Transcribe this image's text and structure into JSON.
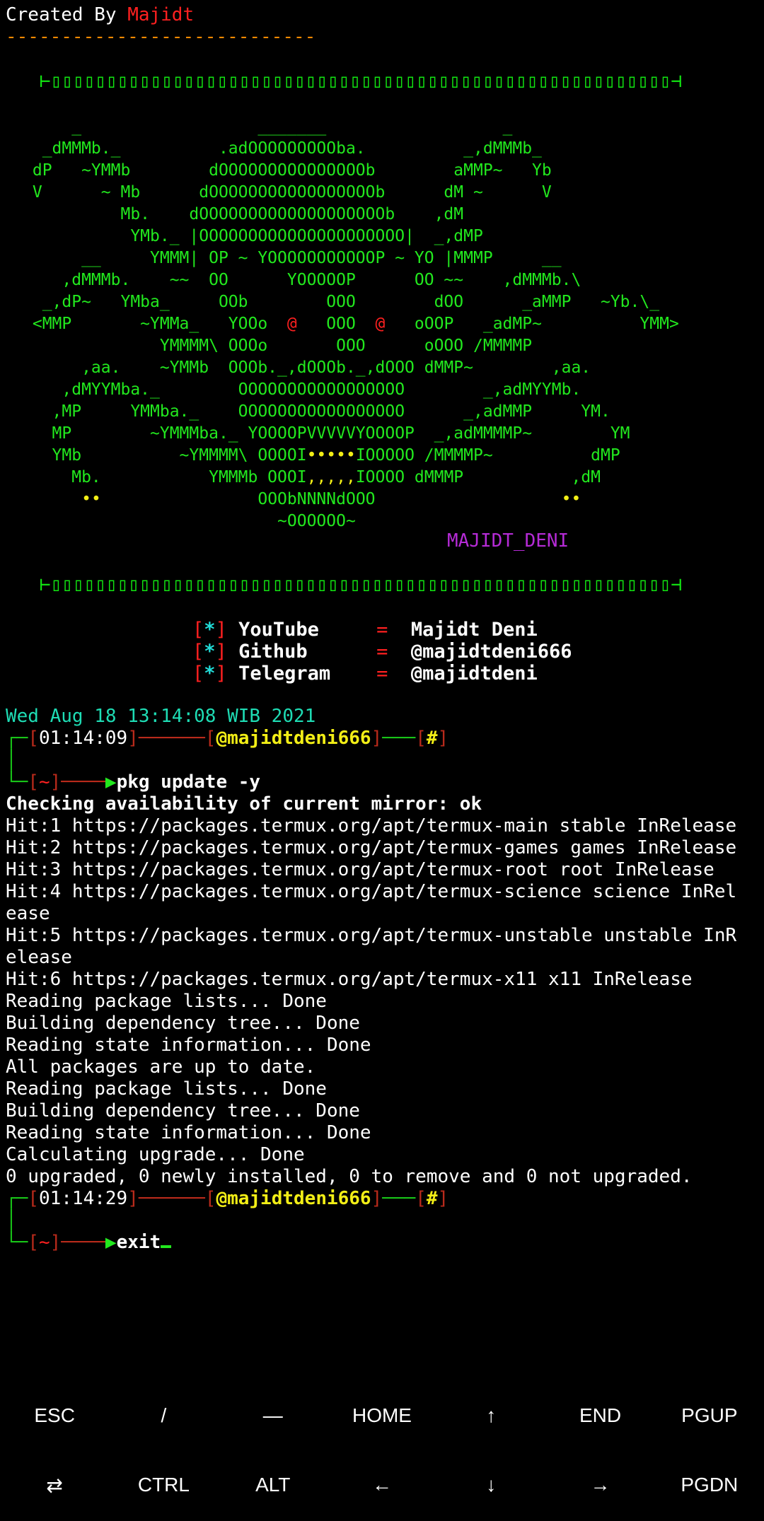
{
  "header": {
    "created_by": "Created By ",
    "author": "Majidt",
    "dashes": "----------------------------"
  },
  "banner": {
    "separator": "⊢▯▯▯▯▯▯▯▯▯▯▯▯▯▯▯▯▯▯▯▯▯▯▯▯▯▯▯▯▯▯▯▯▯▯▯▯▯▯▯▯▯▯▯▯▯▯▯▯▯▯▯▯▯▯▯▯⊣",
    "art_lines": [
      "     _                  _______                  _",
      "  _dMMMb._          .adOOOOOOOOOba.          _,dMMMb_",
      " dP   ~YMMb        dOOOOOOOOOOOOOOOb        aMMP~   Yb",
      " V      ~ Mb      dOOOOOOOOOOOOOOOOOb      dM ~      V",
      "          Mb.    dOOOOOOOOOOOOOOOOOOOb    ,dM",
      "           YMb._ |OOOOOOOOOOOOOOOOOOOOO|  _,dMP",
      "      __     YMMM| OP ~ YOOOOOOOOOOOP ~ YO |MMMP     __",
      "    ,dMMMb.    ~~  OO      YOOOOOP      OO ~~    ,dMMMb.\\",
      "  _,dP~   YMba_     OOb        OOO        dOO      _aMMP   ~Yb.\\_",
      " <MMP       ~YMMa_   YOOo  @   OOO  @   oOOP   _adMP~          YMM>",
      "              YMMMM\\ OOOo       OOO      oOOO /MMMMP",
      "      ,aa.    ~YMMb  OOOb._,dOOOb._,dOOO dMMP~        ,aa.",
      "    ,dMYYMba._        OOOOOOOOOOOOOOOOO        _,adMYYMb.",
      "   ,MP     YMMba._    OOOOOOOOOOOOOOOOO      _,adMMP     YM.",
      "   MP        ~YMMMba._ YOOOOPVVVVVYOOOOP  _,adMMMMP~        YM",
      "   YMb          ~YMMMM\\ OOOOI•••••IOOOOO /MMMMP~          dMP",
      "     Mb.           YMMMb OOOI,,,,,IOOOO dMMMP           ,dM",
      "      ••                OOObNNNNdOOO                   ••",
      "                          ~OOOOOO~"
    ],
    "signature": "MAJIDT_DENI"
  },
  "links": [
    {
      "label": "YouTube ",
      "eq": "=",
      "value": "Majidt Deni"
    },
    {
      "label": "Github  ",
      "eq": "=",
      "value": "@majidtdeni666"
    },
    {
      "label": "Telegram",
      "eq": "=",
      "value": "@majidtdeni"
    }
  ],
  "bracket_star": "*",
  "date_line": "Wed Aug 18 13:14:08 WIB 2021",
  "prompt1": {
    "time": "01:14:09",
    "user": "@majidtdeni666",
    "mark": "#",
    "dir": "~",
    "command": "pkg update -y"
  },
  "output": [
    "Checking availability of current mirror: ok",
    "Hit:1 https://packages.termux.org/apt/termux-main stable InRelease",
    "Hit:2 https://packages.termux.org/apt/termux-games games InRelease",
    "Hit:3 https://packages.termux.org/apt/termux-root root InRelease",
    "Hit:4 https://packages.termux.org/apt/termux-science science InRel",
    "ease",
    "Hit:5 https://packages.termux.org/apt/termux-unstable unstable InR",
    "elease",
    "Hit:6 https://packages.termux.org/apt/termux-x11 x11 InRelease",
    "Reading package lists... Done",
    "Building dependency tree... Done",
    "Reading state information... Done",
    "All packages are up to date.",
    "Reading package lists... Done",
    "Building dependency tree... Done",
    "Reading state information... Done",
    "Calculating upgrade... Done",
    "0 upgraded, 0 newly installed, 0 to remove and 0 not upgraded."
  ],
  "prompt2": {
    "time": "01:14:29",
    "user": "@majidtdeni666",
    "mark": "#",
    "dir": "~",
    "command": "exit"
  },
  "extra_keys": {
    "row1": [
      "ESC",
      "/",
      "—",
      "HOME",
      "↑",
      "END",
      "PGUP"
    ],
    "row2": [
      "⇄",
      "CTRL",
      "ALT",
      "←",
      "↓",
      "→",
      "PGDN"
    ]
  }
}
